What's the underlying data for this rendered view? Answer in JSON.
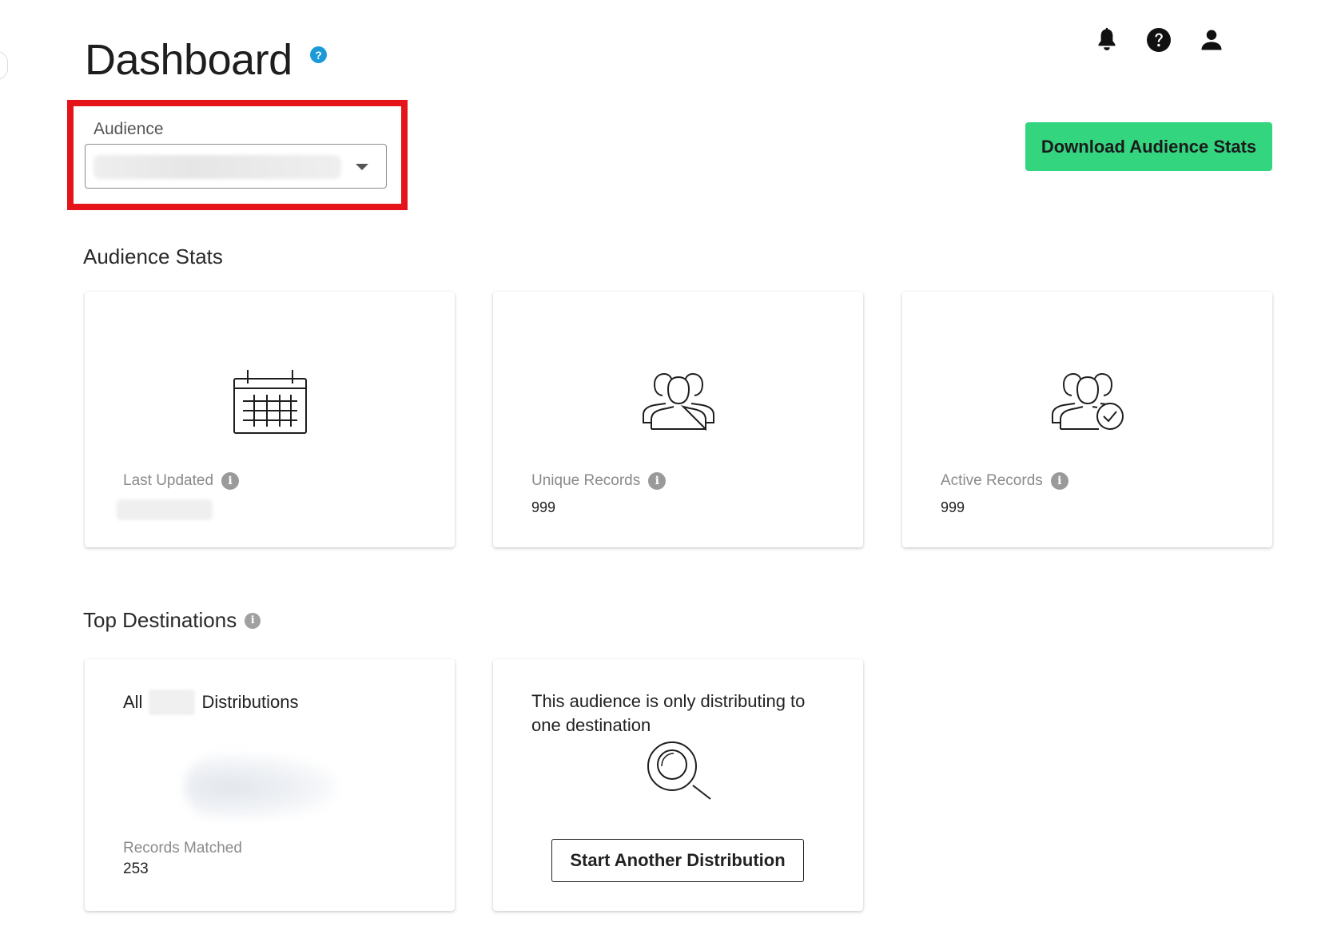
{
  "header": {
    "title": "Dashboard",
    "help_glyph": "?",
    "icons": [
      "bell-icon",
      "help-circle-icon",
      "user-icon"
    ]
  },
  "audience": {
    "label": "Audience",
    "selected_value": ""
  },
  "actions": {
    "download_label": "Download Audience Stats"
  },
  "audience_stats": {
    "title": "Audience Stats",
    "cards": [
      {
        "icon": "calendar-icon",
        "label": "Last Updated",
        "value": ""
      },
      {
        "icon": "users-icon",
        "label": "Unique Records",
        "value": "999"
      },
      {
        "icon": "users-check-icon",
        "label": "Active Records",
        "value": "999"
      }
    ]
  },
  "top_destinations": {
    "title": "Top Destinations",
    "card_all": {
      "prefix": "All",
      "blurred_word": "",
      "suffix": "Distributions",
      "metric_label": "Records Matched",
      "metric_value": "253"
    },
    "card_single": {
      "message": "This audience is only distributing to one destination",
      "icon": "magnifier-icon",
      "button_label": "Start Another Distribution"
    }
  },
  "colors": {
    "accent_green": "#34d57f",
    "help_blue": "#1a9ad9",
    "highlight_red": "#e5131a"
  }
}
